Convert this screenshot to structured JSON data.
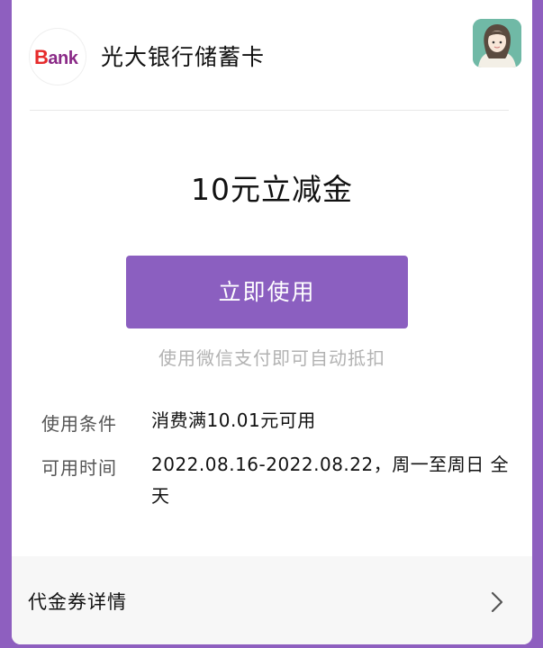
{
  "header": {
    "logo_text_b": "B",
    "logo_text_rest": "ank",
    "bank_name": "光大银行储蓄卡"
  },
  "coupon": {
    "title": "10元立减金",
    "use_button": "立即使用",
    "hint": "使用微信支付即可自动抵扣"
  },
  "details": {
    "condition_label": "使用条件",
    "condition_value": "消费满10.01元可用",
    "time_label": "可用时间",
    "time_value": "2022.08.16-2022.08.22，周一至周日 全天"
  },
  "footer": {
    "details_label": "代金券详情"
  },
  "icons": {
    "logo": "bank-logo-icon",
    "avatar": "user-avatar-icon",
    "chevron": "chevron-right-icon"
  },
  "colors": {
    "accent": "#8b5fc0",
    "background": "#8e5fbf",
    "hint": "#b2b2b2"
  }
}
